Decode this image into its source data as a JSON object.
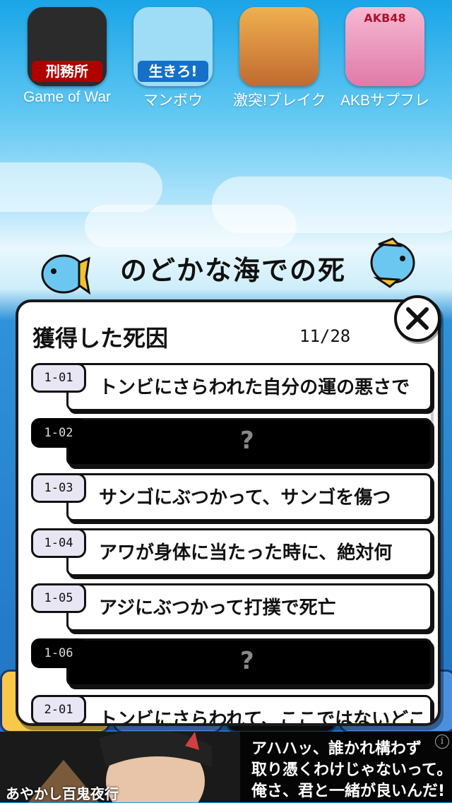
{
  "apps": [
    {
      "name": "Game of War",
      "caption": "刑務所",
      "icon": "prison-game-icon",
      "color": "#2b2b2b",
      "caption_color": "#b00000"
    },
    {
      "name": "マンボウ",
      "caption": "生きろ!",
      "icon": "sunfish-game-icon",
      "color": "#9fdcf5",
      "caption_color": "#1470c8"
    },
    {
      "name": "激突!ブレイク学園",
      "caption": "",
      "icon": "break-academy-game-icon",
      "color": "#f0b050",
      "caption_color": ""
    },
    {
      "name": "AKBサプフレ",
      "caption": "AKB48",
      "icon": "akb-game-icon",
      "color": "#f6b9d2",
      "caption_color": "#b0102a"
    }
  ],
  "stage_title": "のどかな海での死",
  "modal": {
    "title": "獲得した死因",
    "count": "11/28",
    "close_icon": "close-icon",
    "rows": [
      {
        "id": "1-01",
        "text": "トンビにさらわれた自分の運の悪さで",
        "locked": false
      },
      {
        "id": "1-02",
        "text": "?",
        "locked": true
      },
      {
        "id": "1-03",
        "text": "サンゴにぶつかって、サンゴを傷つ",
        "locked": false
      },
      {
        "id": "1-04",
        "text": "アワが身体に当たった時に、絶対何",
        "locked": false
      },
      {
        "id": "1-05",
        "text": "アジにぶつかって打撲で死亡",
        "locked": false
      },
      {
        "id": "1-06",
        "text": "?",
        "locked": true
      },
      {
        "id": "2-01",
        "text": "トンビにさらわれて、ここではないどこ",
        "locked": false
      }
    ]
  },
  "ad": {
    "logo": "あやかし百鬼夜行",
    "lines": [
      "アハハッ、誰かれ構わず",
      "取り憑くわけじゃないって。",
      "俺さ、君と一緒が良いんだ!"
    ],
    "info_icon": "info-icon",
    "info_label": "i"
  },
  "colors": {
    "accent": "#1e6fc0",
    "locked": "#000000",
    "tag": "#e9e6f3"
  }
}
